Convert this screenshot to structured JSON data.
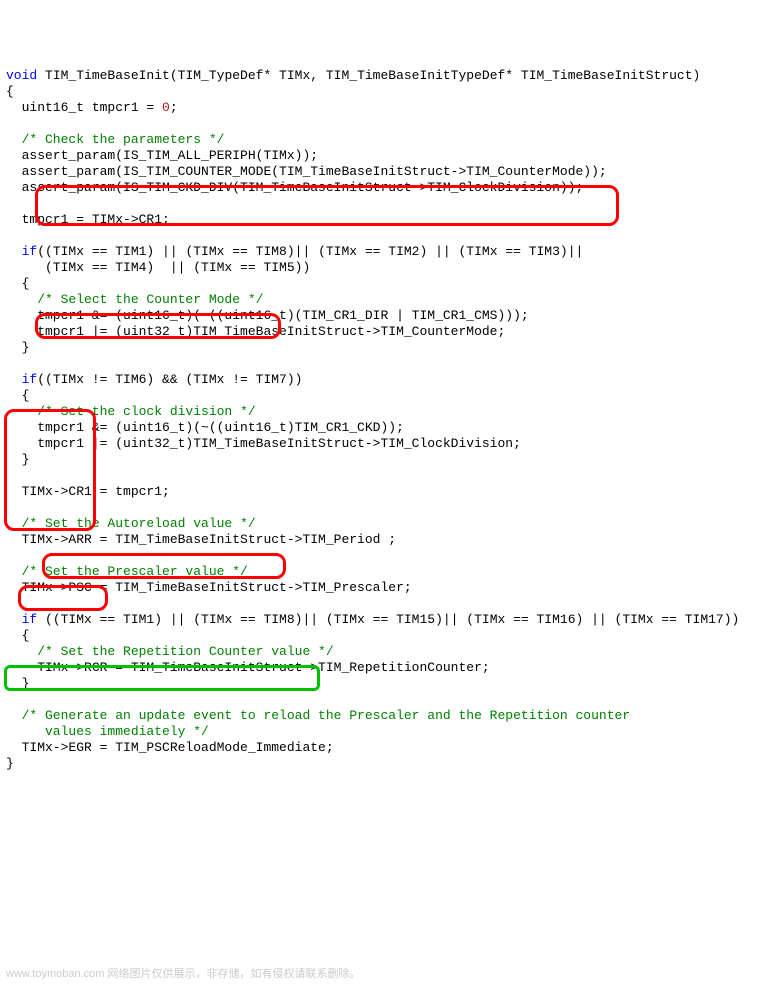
{
  "l01a": "void",
  "l01b": " TIM_TimeBaseInit(TIM_TypeDef* TIMx, TIM_TimeBaseInitTypeDef* TIM_TimeBaseInitStruct)",
  "l02": "{",
  "l03a": "  uint16_t tmpcr1 = ",
  "l03b": "0",
  "l03c": ";",
  "l04": "",
  "l05": "  /* Check the parameters */",
  "l06": "  assert_param(IS_TIM_ALL_PERIPH(TIMx));",
  "l07": "  assert_param(IS_TIM_COUNTER_MODE(TIM_TimeBaseInitStruct->TIM_CounterMode));",
  "l08": "  assert_param(IS_TIM_CKD_DIV(TIM_TimeBaseInitStruct->TIM_ClockDivision));",
  "l09": "",
  "l10": "  tmpcr1 = TIMx->CR1;",
  "l11": "",
  "l12a": "  if",
  "l12b": "((TIMx == TIM1) || (TIMx == TIM8)|| (TIMx == TIM2) || (TIMx == TIM3)||",
  "l13": "     (TIMx == TIM4)  || (TIMx == TIM5))",
  "l14": "  {",
  "l15": "    /* Select the Counter Mode */",
  "l16": "    tmpcr1 &= (uint16_t)(~((uint16_t)(TIM_CR1_DIR | TIM_CR1_CMS)));",
  "l17": "    tmpcr1 |= (uint32_t)TIM_TimeBaseInitStruct->TIM_CounterMode;",
  "l18": "  }",
  "l19": "",
  "l20a": "  if",
  "l20b": "((TIMx != TIM6) && (TIMx != TIM7))",
  "l21": "  {",
  "l22": "    /* Set the clock division */",
  "l23": "    tmpcr1 &= (uint16_t)(~((uint16_t)TIM_CR1_CKD));",
  "l24": "    tmpcr1 |= (uint32_t)TIM_TimeBaseInitStruct->TIM_ClockDivision;",
  "l25": "  }",
  "l26": "",
  "l27": "  TIMx->CR1 = tmpcr1;",
  "l28": "",
  "l29": "  /* Set the Autoreload value */",
  "l30": "  TIMx->ARR = TIM_TimeBaseInitStruct->TIM_Period ;",
  "l31": "",
  "l32": "  /* Set the Prescaler value */",
  "l33": "  TIMx->PSC = TIM_TimeBaseInitStruct->TIM_Prescaler;",
  "l34": "",
  "l35a": "  if",
  "l35b": " ((TIMx == TIM1) || (TIMx == TIM8)|| (TIMx == TIM15)|| (TIMx == TIM16) || (TIMx == TIM17))",
  "l36": "  {",
  "l37": "    /* Set the Repetition Counter value */",
  "l38": "    TIMx->RCR = TIM_TimeBaseInitStruct->TIM_RepetitionCounter;",
  "l39": "  }",
  "l40": "",
  "l41": "  /* Generate an update event to reload the Prescaler and the Repetition counter",
  "l42": "     values immediately */",
  "l43": "  TIMx->EGR = TIM_PSCReloadMode_Immediate;",
  "l44": "}",
  "watermark": "www.toymoban.com  网络图片仅供展示，非存储，如有侵权请联系删除。"
}
